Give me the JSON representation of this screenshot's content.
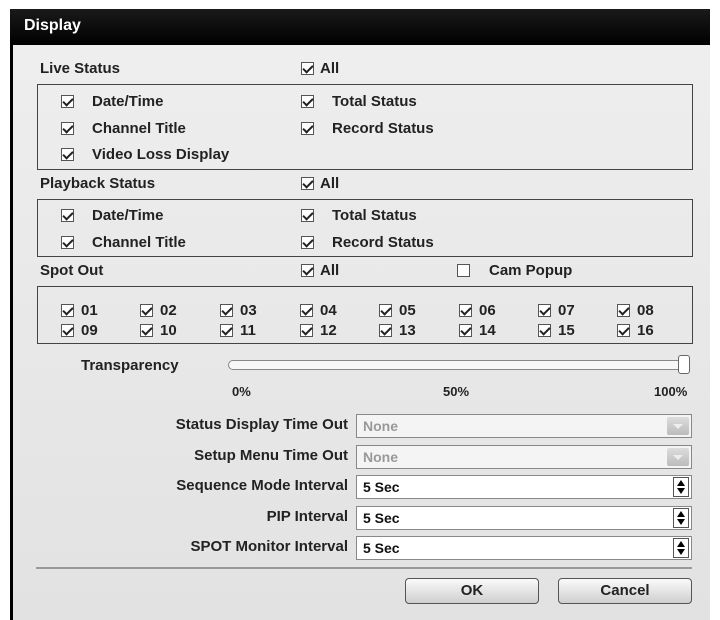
{
  "window": {
    "title": "Display"
  },
  "live_status": {
    "label": "Live Status",
    "all": {
      "label": "All",
      "checked": true
    },
    "options": [
      {
        "label": "Date/Time",
        "checked": true
      },
      {
        "label": "Total Status",
        "checked": true
      },
      {
        "label": "Channel Title",
        "checked": true
      },
      {
        "label": "Record Status",
        "checked": true
      },
      {
        "label": "Video Loss Display",
        "checked": true
      }
    ]
  },
  "playback_status": {
    "label": "Playback Status",
    "all": {
      "label": "All",
      "checked": true
    },
    "options": [
      {
        "label": "Date/Time",
        "checked": true
      },
      {
        "label": "Total Status",
        "checked": true
      },
      {
        "label": "Channel Title",
        "checked": true
      },
      {
        "label": "Record Status",
        "checked": true
      }
    ]
  },
  "spot_out": {
    "label": "Spot Out",
    "all": {
      "label": "All",
      "checked": true
    },
    "cam_popup": {
      "label": "Cam Popup",
      "checked": false
    },
    "channels": [
      "01",
      "02",
      "03",
      "04",
      "05",
      "06",
      "07",
      "08",
      "09",
      "10",
      "11",
      "12",
      "13",
      "14",
      "15",
      "16"
    ]
  },
  "transparency": {
    "label": "Transparency",
    "value_percent": 100,
    "ticks": [
      "0%",
      "50%",
      "100%"
    ]
  },
  "settings": [
    {
      "label": "Status Display Time Out",
      "value": "None",
      "enabled": false
    },
    {
      "label": "Setup Menu Time Out",
      "value": "None",
      "enabled": false
    },
    {
      "label": "Sequence Mode Interval",
      "value": "5 Sec",
      "enabled": true
    },
    {
      "label": "PIP Interval",
      "value": "5 Sec",
      "enabled": true
    },
    {
      "label": "SPOT Monitor Interval",
      "value": "5 Sec",
      "enabled": true
    }
  ],
  "buttons": {
    "ok": "OK",
    "cancel": "Cancel"
  }
}
